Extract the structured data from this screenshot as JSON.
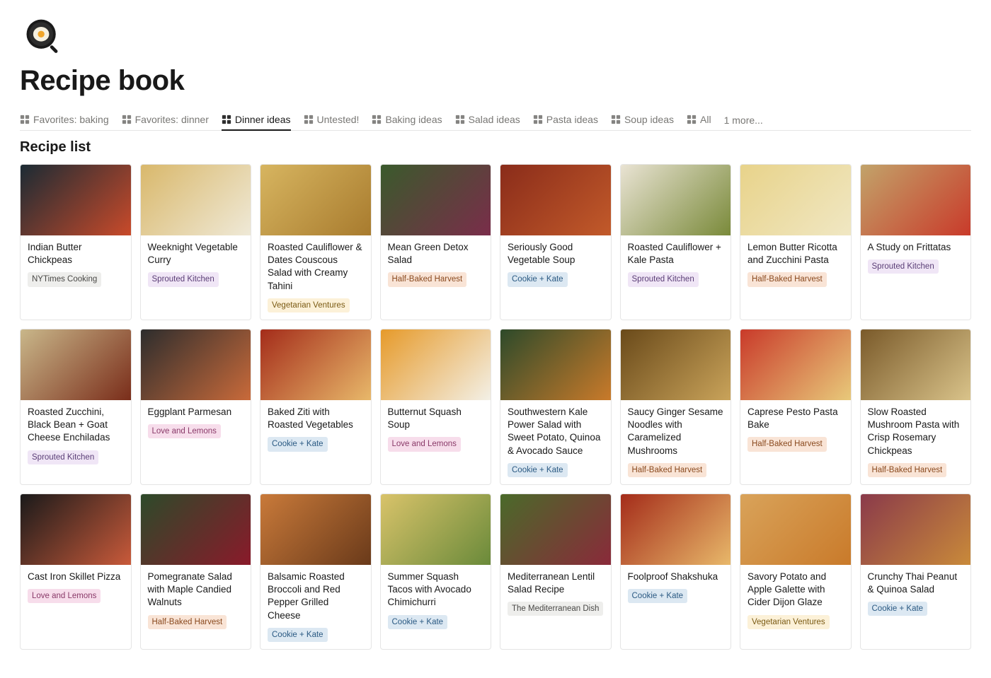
{
  "page": {
    "title": "Recipe book"
  },
  "tabs": [
    {
      "label": "Favorites: baking",
      "active": false
    },
    {
      "label": "Favorites: dinner",
      "active": false
    },
    {
      "label": "Dinner ideas",
      "active": true
    },
    {
      "label": "Untested!",
      "active": false
    },
    {
      "label": "Baking ideas",
      "active": false
    },
    {
      "label": "Salad ideas",
      "active": false
    },
    {
      "label": "Pasta ideas",
      "active": false
    },
    {
      "label": "Soup ideas",
      "active": false
    },
    {
      "label": "All",
      "active": false
    }
  ],
  "more_tabs_label": "1 more...",
  "section_title": "Recipe list",
  "tag_colors": {
    "NYTimes Cooking": {
      "bg": "#EEEEEC",
      "fg": "#494846"
    },
    "Sprouted Kitchen": {
      "bg": "#F0E6F6",
      "fg": "#5A3D76"
    },
    "Vegetarian Ventures": {
      "bg": "#FCF1D8",
      "fg": "#7A5A13"
    },
    "Half-Baked Harvest": {
      "bg": "#F9E4D6",
      "fg": "#8A4A1F"
    },
    "Cookie + Kate": {
      "bg": "#DCE8F2",
      "fg": "#2B5A83"
    },
    "Love and Lemons": {
      "bg": "#F7DDEB",
      "fg": "#8A3A69"
    },
    "The Mediterranean Dish": {
      "bg": "#EEEEEC",
      "fg": "#494846"
    }
  },
  "recipes": [
    {
      "title": "Indian Butter Chickpeas",
      "source": "NYTimes Cooking",
      "img": {
        "c1": "#1b2b34",
        "c2": "#c94a2a"
      }
    },
    {
      "title": "Weeknight Vegetable Curry",
      "source": "Sprouted Kitchen",
      "img": {
        "c1": "#d9b86b",
        "c2": "#efe9d7"
      }
    },
    {
      "title": "Roasted Cauliflower & Dates Couscous Salad with Creamy Tahini",
      "source": "Vegetarian Ventures",
      "img": {
        "c1": "#d7b560",
        "c2": "#a87b2e"
      }
    },
    {
      "title": "Mean Green Detox Salad",
      "source": "Half-Baked Harvest",
      "img": {
        "c1": "#3a5a2c",
        "c2": "#7a2d4a"
      }
    },
    {
      "title": "Seriously Good Vegetable Soup",
      "source": "Cookie + Kate",
      "img": {
        "c1": "#8a2c1a",
        "c2": "#c25a2a"
      }
    },
    {
      "title": "Roasted Cauliflower + Kale Pasta",
      "source": "Sprouted Kitchen",
      "img": {
        "c1": "#e9e3d3",
        "c2": "#7a8a3a"
      }
    },
    {
      "title": "Lemon Butter Ricotta and Zucchini Pasta",
      "source": "Half-Baked Harvest",
      "img": {
        "c1": "#e8d38a",
        "c2": "#f0e7c3"
      }
    },
    {
      "title": "A Study on Frittatas",
      "source": "Sprouted Kitchen",
      "img": {
        "c1": "#c2a36a",
        "c2": "#c93a2a"
      }
    },
    {
      "title": "Roasted Zucchini, Black Bean + Goat Cheese Enchiladas",
      "source": "Sprouted Kitchen",
      "img": {
        "c1": "#c9b78a",
        "c2": "#7a2d1a"
      }
    },
    {
      "title": "Eggplant Parmesan",
      "source": "Love and Lemons",
      "img": {
        "c1": "#2d2d2d",
        "c2": "#c96a3a"
      }
    },
    {
      "title": "Baked Ziti with Roasted Vegetables",
      "source": "Cookie + Kate",
      "img": {
        "c1": "#a42c1a",
        "c2": "#e8b86a"
      }
    },
    {
      "title": "Butternut Squash Soup",
      "source": "Love and Lemons",
      "img": {
        "c1": "#e69a2a",
        "c2": "#f3f0e6"
      }
    },
    {
      "title": "Southwestern Kale Power Salad with Sweet Potato, Quinoa & Avocado Sauce",
      "source": "Cookie + Kate",
      "img": {
        "c1": "#2d4a2a",
        "c2": "#c97a2a"
      }
    },
    {
      "title": "Saucy Ginger Sesame Noodles with Caramelized Mushrooms",
      "source": "Half-Baked Harvest",
      "img": {
        "c1": "#6a4a1a",
        "c2": "#c9a35a"
      }
    },
    {
      "title": "Caprese Pesto Pasta Bake",
      "source": "Half-Baked Harvest",
      "img": {
        "c1": "#c93a2a",
        "c2": "#e8c97a"
      }
    },
    {
      "title": "Slow Roasted Mushroom Pasta with Crisp Rosemary Chickpeas",
      "source": "Half-Baked Harvest",
      "img": {
        "c1": "#7a5a2a",
        "c2": "#d9c38a"
      }
    },
    {
      "title": "Cast Iron Skillet Pizza",
      "source": "Love and Lemons",
      "img": {
        "c1": "#1a1a1a",
        "c2": "#c95a3a"
      }
    },
    {
      "title": "Pomegranate Salad with Maple Candied Walnuts",
      "source": "Half-Baked Harvest",
      "img": {
        "c1": "#2d4a2a",
        "c2": "#8a1a2a"
      }
    },
    {
      "title": "Balsamic Roasted Broccoli and Red Pepper Grilled Cheese",
      "source": "Cookie + Kate",
      "img": {
        "c1": "#c97a3a",
        "c2": "#6a3a1a"
      }
    },
    {
      "title": "Summer Squash Tacos with Avocado Chimichurri",
      "source": "Cookie + Kate",
      "img": {
        "c1": "#d9c36a",
        "c2": "#6a8a3a"
      }
    },
    {
      "title": "Mediterranean Lentil Salad Recipe",
      "source": "The Mediterranean Dish",
      "img": {
        "c1": "#4a6a2a",
        "c2": "#8a2a3a"
      }
    },
    {
      "title": "Foolproof Shakshuka",
      "source": "Cookie + Kate",
      "img": {
        "c1": "#a42c1a",
        "c2": "#e8b86a"
      }
    },
    {
      "title": "Savory Potato and Apple Galette with Cider Dijon Glaze",
      "source": "Vegetarian Ventures",
      "img": {
        "c1": "#d9a35a",
        "c2": "#c97a2a"
      }
    },
    {
      "title": "Crunchy Thai Peanut & Quinoa Salad",
      "source": "Cookie + Kate",
      "img": {
        "c1": "#8a3a4a",
        "c2": "#c98a3a"
      }
    }
  ]
}
